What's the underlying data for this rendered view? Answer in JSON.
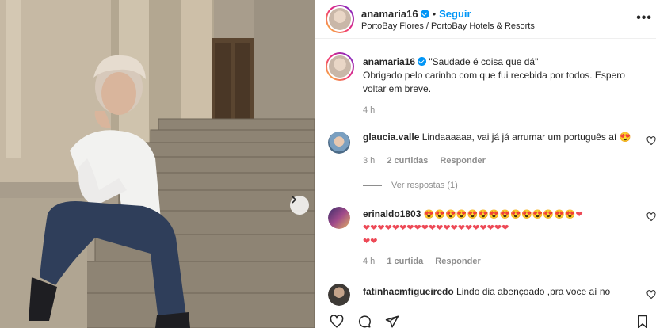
{
  "post": {
    "username": "anamaria16",
    "follow_label": "Seguir",
    "location": "PortoBay Flores / PortoBay Hotels & Resorts",
    "caption_line1": "\"Saudade é coisa que dá\"",
    "caption_line2": "Obrigado pelo carinho com que fui recebida por todos. Espero",
    "caption_line3": "voltar em breve.",
    "time": "4 h"
  },
  "comments": [
    {
      "username": "glaucia.valle",
      "text": "Lindaaaaaa, vai já já arrumar um português aí 😍",
      "time": "3 h",
      "likes": "2 curtidas",
      "reply": "Responder",
      "view_replies": "Ver respostas (1)"
    },
    {
      "username": "erinaldo1803",
      "emoji_line1": "😍😍😍😍😍😍😍😍😍😍😍😍😍😍❤",
      "emoji_line2": "❤❤❤❤❤❤❤❤❤❤❤❤❤❤❤❤❤❤❤❤",
      "emoji_line3": "❤❤",
      "time": "4 h",
      "likes": "1 curtida",
      "reply": "Responder"
    },
    {
      "username": "fatinhacmfigueiredo",
      "text": "Lindo dia abençoado ,pra voce aí no"
    }
  ],
  "colors": {
    "accent": "#0095f6",
    "muted": "#8e8e8e",
    "heart": "#ed4956"
  },
  "icons": [
    "verified-badge-icon",
    "more-options-icon",
    "next-arrow-icon",
    "heart-icon",
    "comment-icon",
    "share-icon"
  ]
}
